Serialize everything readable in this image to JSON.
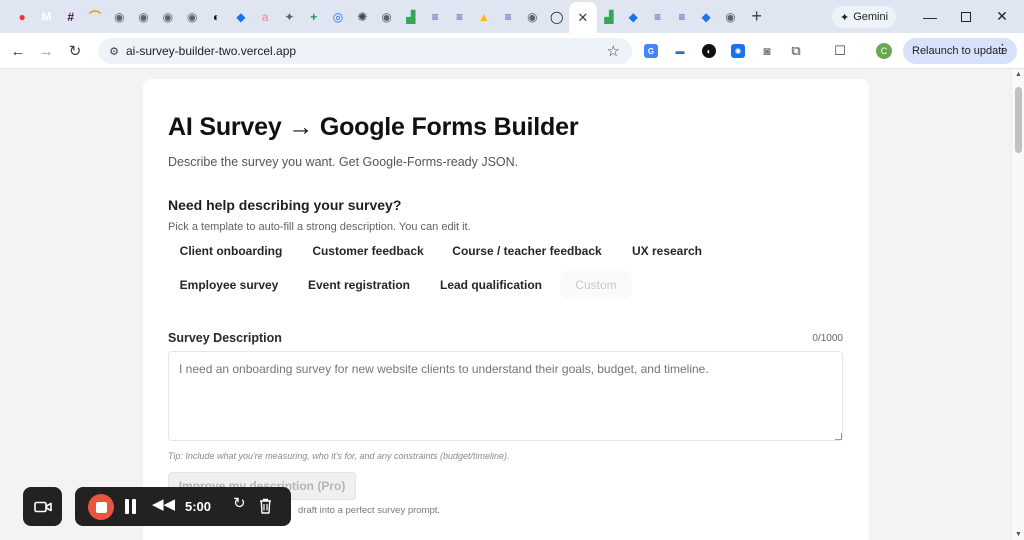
{
  "browser": {
    "tabs": [
      {
        "icon": "youtube-icon",
        "color": "#e53935",
        "glyph": "●"
      },
      {
        "icon": "gmail-icon",
        "color": "#ffffff",
        "glyph": "M"
      },
      {
        "icon": "slack-icon",
        "color": "#4a154b",
        "glyph": "#"
      },
      {
        "icon": "rainbow-icon",
        "color": "#fb8c00",
        "glyph": "⌒"
      },
      {
        "icon": "globe-icon",
        "color": "#5f6368",
        "glyph": "◉"
      },
      {
        "icon": "globe-icon",
        "color": "#5f6368",
        "glyph": "◉"
      },
      {
        "icon": "globe-icon",
        "color": "#5f6368",
        "glyph": "◉"
      },
      {
        "icon": "globe-icon",
        "color": "#5f6368",
        "glyph": "◉"
      },
      {
        "icon": "perplexity-icon",
        "color": "#111111",
        "glyph": "◐"
      },
      {
        "icon": "blue-square-icon",
        "color": "#1a73e8",
        "glyph": "◆"
      },
      {
        "icon": "ads-icon",
        "color": "#e8a0a0",
        "glyph": "a"
      },
      {
        "icon": "tool-icon",
        "color": "#5f6368",
        "glyph": "✦"
      },
      {
        "icon": "sheets-plus-icon",
        "color": "#0f9d58",
        "glyph": "+"
      },
      {
        "icon": "blue-circle-icon",
        "color": "#1a73e8",
        "glyph": "◎"
      },
      {
        "icon": "chatgpt-icon",
        "color": "#444444",
        "glyph": "✺"
      },
      {
        "icon": "globe-icon",
        "color": "#5f6368",
        "glyph": "◉"
      },
      {
        "icon": "chart-icon",
        "color": "#34a853",
        "glyph": "▟"
      },
      {
        "icon": "forms-icon",
        "color": "#673ab7",
        "glyph": "≡"
      },
      {
        "icon": "forms-icon",
        "color": "#673ab7",
        "glyph": "≡"
      },
      {
        "icon": "drive-icon",
        "color": "#fbbc04",
        "glyph": "▲"
      },
      {
        "icon": "forms-icon",
        "color": "#673ab7",
        "glyph": "≡"
      },
      {
        "icon": "globe-icon",
        "color": "#5f6368",
        "glyph": "◉"
      },
      {
        "icon": "github-icon",
        "color": "#111111",
        "glyph": "◯"
      },
      {
        "icon": "close-icon",
        "color": "#3c4043",
        "glyph": "✕",
        "active": true
      },
      {
        "icon": "chart-icon",
        "color": "#34a853",
        "glyph": "▟"
      },
      {
        "icon": "blue-square-icon",
        "color": "#1a73e8",
        "glyph": "◆"
      },
      {
        "icon": "forms-icon",
        "color": "#673ab7",
        "glyph": "≡"
      },
      {
        "icon": "forms-icon",
        "color": "#673ab7",
        "glyph": "≡"
      },
      {
        "icon": "blue-square-icon",
        "color": "#1a73e8",
        "glyph": "◆"
      },
      {
        "icon": "chrome-icon",
        "color": "#5f6368",
        "glyph": "◉"
      }
    ],
    "new_tab": "+",
    "gemini_label": "Gemini",
    "url": "ai-survey-builder-two.vercel.app",
    "avatar_letter": "C",
    "relaunch_label": "Relaunch to update"
  },
  "page": {
    "title": "AI Survey → Google Forms Builder",
    "subtitle": "Describe the survey you want. Get Google-Forms-ready JSON.",
    "help_title": "Need help describing your survey?",
    "help_subtitle": "Pick a template to auto-fill a strong description. You can edit it.",
    "templates": [
      {
        "label": "Client onboarding"
      },
      {
        "label": "Customer feedback"
      },
      {
        "label": "Course / teacher feedback"
      },
      {
        "label": "UX research"
      },
      {
        "label": "Employee survey"
      },
      {
        "label": "Event registration"
      },
      {
        "label": "Lead qualification"
      },
      {
        "label": "Custom",
        "disabled": true
      }
    ],
    "description_label": "Survey Description",
    "char_counter": "0/1000",
    "description_placeholder": "I need an onboarding survey for new website clients to understand their goals, budget, and timeline.",
    "tip": "Tip: Include what you're measuring, who it's for, and any constraints (budget/timeline).",
    "improve_button": "Improve my description (Pro)",
    "improve_hint": "draft into a perfect survey prompt."
  },
  "recorder": {
    "time": "5:00"
  },
  "colors": {
    "tab_strip": "#dfe6f2",
    "record_red": "#e8563f",
    "recorder_bg": "#222222",
    "relaunch_bg": "#d6e2fb"
  }
}
